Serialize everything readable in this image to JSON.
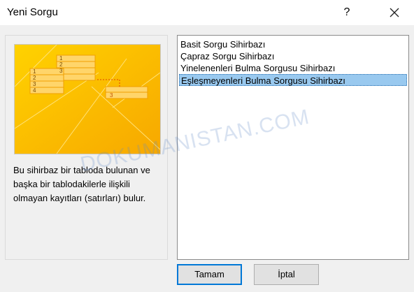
{
  "window": {
    "title": "Yeni Sorgu",
    "help_label": "?",
    "close_icon": "close-icon"
  },
  "wizard": {
    "description": "Bu sihirbaz bir tabloda bulunan ve başka bir tablodakilerle ilişkili olmayan kayıtları (satırları) bulur.",
    "preview_numbers": [
      "1",
      "2",
      "3",
      "1",
      "2",
      "3",
      "4",
      "3"
    ],
    "preview_colors": {
      "background": "#ffbf00",
      "accent": "#f5a300",
      "cell": "#ffd56a"
    }
  },
  "options": {
    "items": [
      "Basit Sorgu Sihirbazı",
      "Çapraz Sorgu Sihirbazı",
      "Yinelenenleri Bulma Sorgusu Sihirbazı",
      "Eşleşmeyenleri Bulma Sorgusu Sihirbazı"
    ],
    "selected_index": 3
  },
  "buttons": {
    "ok_label": "Tamam",
    "cancel_label": "İptal"
  },
  "watermark": "DOKUMANISTAN.COM"
}
